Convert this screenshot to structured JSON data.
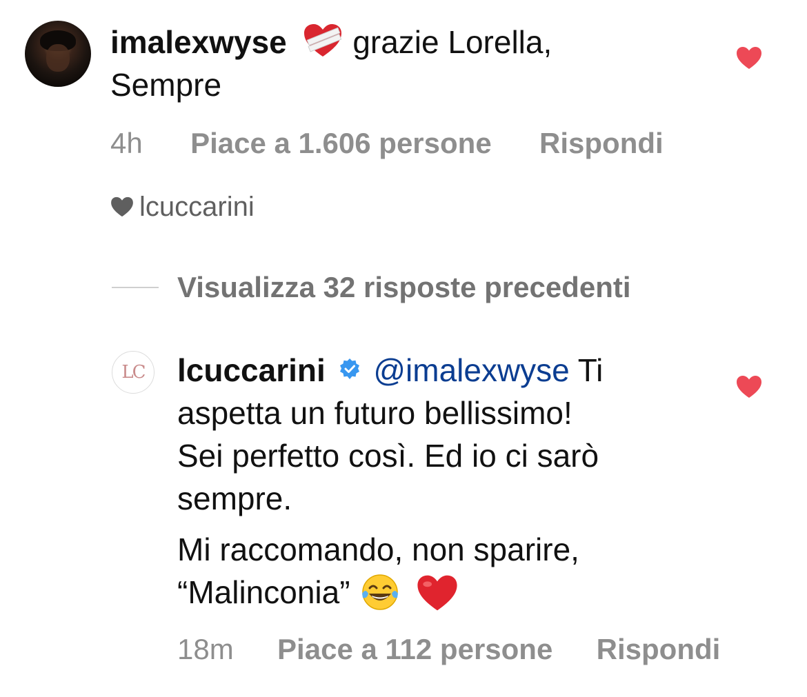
{
  "comment1": {
    "username": "imalexwyse",
    "text_line1": "grazie Lorella,",
    "text_line2": "Sempre",
    "emoji": "mending-heart",
    "time": "4h",
    "likes": "Piace a 1.606 persone",
    "reply": "Rispondi",
    "liked_by_author": "lcuccarini"
  },
  "view_replies": "Visualizza 32 risposte precedenti",
  "comment2": {
    "username": "lcuccarini",
    "avatar_text": "LC",
    "mention": "@imalexwyse",
    "text_line1_tail": "Ti",
    "text_line2": "aspetta un futuro bellissimo!",
    "text_line3": "Sei perfetto così. Ed io ci sarò",
    "text_line4": "sempre.",
    "text_line5": "Mi raccomando, non sparire,",
    "text_line6": "“Malinconia”",
    "emojis": [
      "face-with-tears-of-joy",
      "red-heart"
    ],
    "time": "18m",
    "likes": "Piace a 112 persone",
    "reply": "Rispondi"
  },
  "colors": {
    "like_heart": "#ed4956",
    "verified": "#3897f0",
    "mention": "#0b3d91",
    "meta_text": "#8e8e8e"
  }
}
